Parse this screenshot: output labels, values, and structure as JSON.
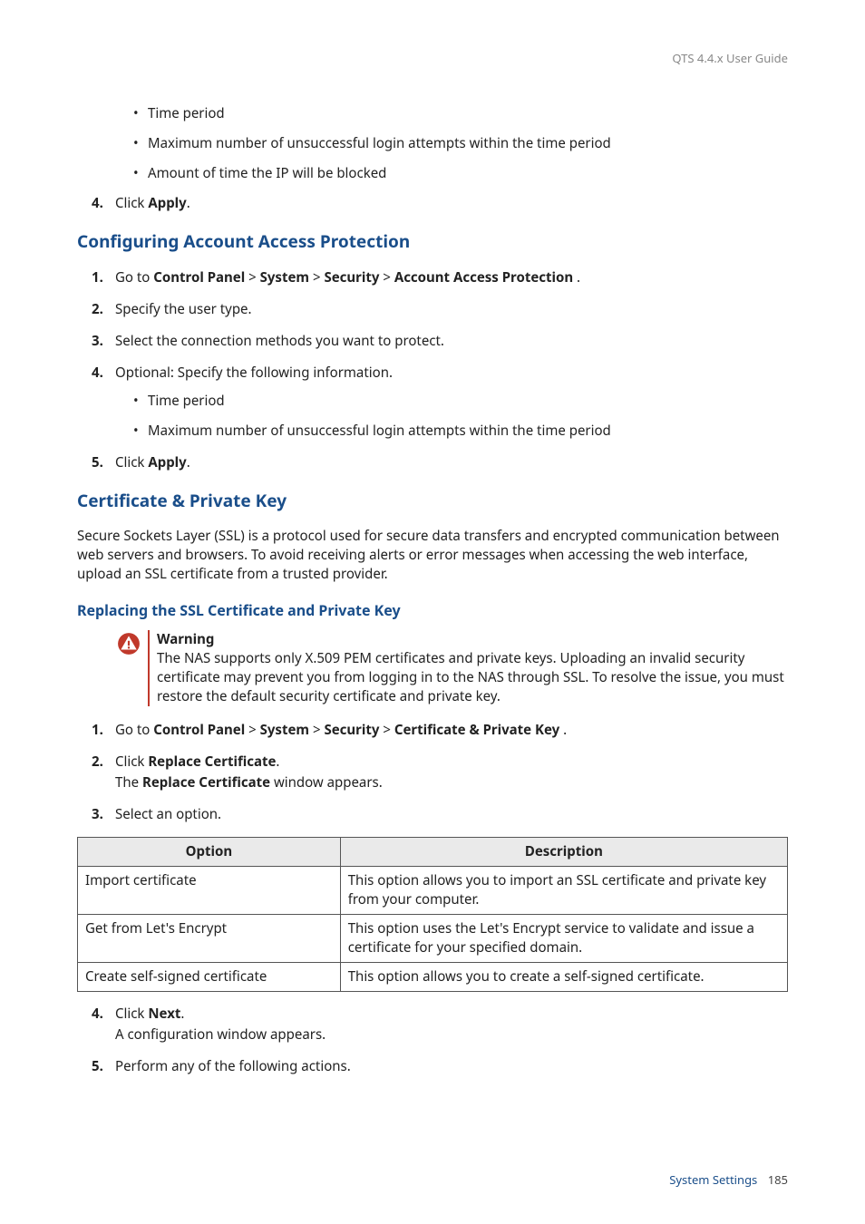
{
  "header": {
    "doc_title": "QTS 4.4.x User Guide"
  },
  "pre_list": {
    "items": [
      "Time period",
      "Maximum number of unsuccessful login attempts within the time period",
      "Amount of time the IP will be blocked"
    ],
    "step4_num": "4.",
    "step4_pre": "Click ",
    "step4_bold": "Apply",
    "step4_post": "."
  },
  "section1": {
    "title": "Configuring Account Access Protection",
    "steps": [
      {
        "num": "1.",
        "pre": "Go to ",
        "bold1": "Control Panel",
        "sep1": " > ",
        "bold2": "System",
        "sep2": " > ",
        "bold3": "Security",
        "sep3": " > ",
        "bold4": "Account Access Protection",
        "post": " ."
      },
      {
        "num": "2.",
        "plain": "Specify the user type."
      },
      {
        "num": "3.",
        "plain": "Select the connection methods you want to protect."
      },
      {
        "num": "4.",
        "plain": "Optional: Specify the following information.",
        "sub": [
          "Time period",
          "Maximum number of unsuccessful login attempts within the time period"
        ]
      },
      {
        "num": "5.",
        "pre": "Click ",
        "bold1": "Apply",
        "post": "."
      }
    ]
  },
  "section2": {
    "title": "Certificate & Private Key",
    "para": "Secure Sockets Layer (SSL) is a protocol used for secure data transfers and encrypted communication between web servers and browsers. To avoid receiving alerts or error messages when accessing the web interface, upload an SSL certificate from a trusted provider."
  },
  "section3": {
    "title": "Replacing the SSL Certificate and Private Key",
    "warning": {
      "title": "Warning",
      "body": "The NAS supports only X.509 PEM certificates and private keys. Uploading an invalid security certificate may prevent you from logging in to the NAS through SSL. To resolve the issue, you must restore the default security certificate and private key."
    },
    "steps_a": [
      {
        "num": "1.",
        "pre": "Go to ",
        "bold1": "Control Panel",
        "sep1": " > ",
        "bold2": "System",
        "sep2": " > ",
        "bold3": "Security",
        "sep3": " > ",
        "bold4": "Certificate & Private Key",
        "post": " ."
      },
      {
        "num": "2.",
        "pre": "Click ",
        "bold1": "Replace Certificate",
        "post": ".",
        "sub_pre": "The ",
        "sub_bold": "Replace Certificate",
        "sub_post": " window appears."
      },
      {
        "num": "3.",
        "plain": "Select an option."
      }
    ],
    "table": {
      "headers": [
        "Option",
        "Description"
      ],
      "rows": [
        {
          "opt": "Import certificate",
          "desc": "This option allows you to import an SSL certificate and private key from your computer."
        },
        {
          "opt": "Get from Let's Encrypt",
          "desc": "This option uses the Let's Encrypt service to validate and issue a certificate for your specified domain."
        },
        {
          "opt": "Create self-signed certificate",
          "desc": "This option allows you to create a self-signed certificate."
        }
      ]
    },
    "steps_b": [
      {
        "num": "4.",
        "pre": "Click ",
        "bold1": "Next",
        "post": ".",
        "sub_plain": "A configuration window appears."
      },
      {
        "num": "5.",
        "plain": "Perform any of the following actions."
      }
    ]
  },
  "footer": {
    "section": "System Settings",
    "page": "185"
  }
}
